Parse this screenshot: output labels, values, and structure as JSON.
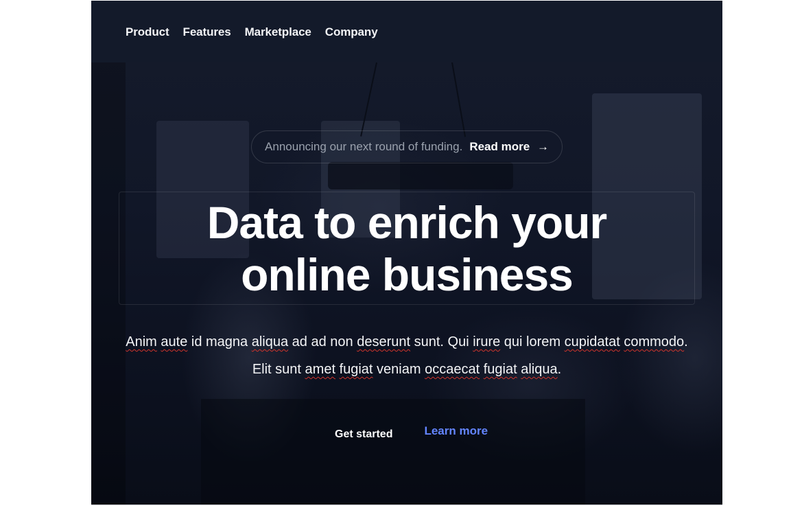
{
  "nav": {
    "items": [
      {
        "label": "Product"
      },
      {
        "label": "Features"
      },
      {
        "label": "Marketplace"
      },
      {
        "label": "Company"
      }
    ]
  },
  "announcement": {
    "text": "Announcing our next round of funding.",
    "link_label": "Read more",
    "arrow": "→"
  },
  "hero": {
    "title": "Data to enrich your online business",
    "lead_parts": [
      "Anim",
      " ",
      "aute",
      " id magna ",
      "aliqua",
      " ad ad non ",
      "deserunt",
      " sunt. Qui ",
      "irure",
      " qui lorem ",
      "cupidatat",
      " ",
      "commodo",
      ". Elit sunt ",
      "amet",
      " ",
      "fugiat",
      " veniam ",
      "occaecat",
      " ",
      "fugiat",
      " ",
      "aliqua",
      "."
    ]
  },
  "actions": {
    "primary_label": "Get started",
    "secondary_label": "Learn more"
  },
  "colors": {
    "background": "#0b1120",
    "topbar": "#131a2a",
    "accent": "#6385ff",
    "spellcheck": "#d0342c"
  }
}
